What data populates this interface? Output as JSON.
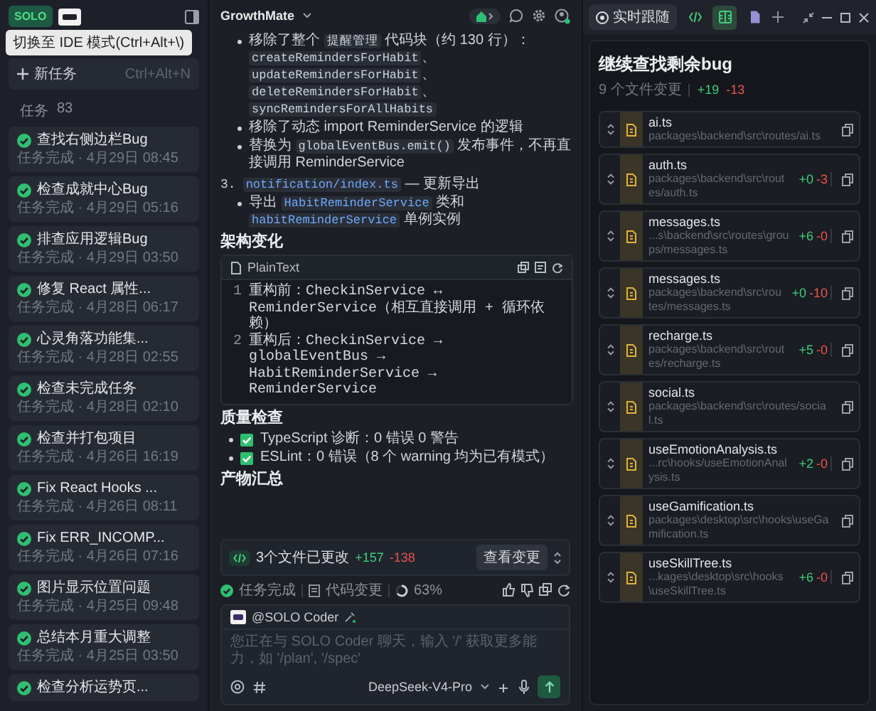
{
  "sidebar": {
    "badge": "SOLO",
    "tooltip": "切换至 IDE 模式(Ctrl+Alt+\\)",
    "new_task": {
      "label": "新任务",
      "shortcut": "Ctrl+Alt+N"
    },
    "tasks_label": "任务",
    "tasks_count": "83",
    "tasks": [
      {
        "title": "查找右侧边栏Bug",
        "subtitle": "任务完成 · 4月29日 08:45"
      },
      {
        "title": "检查成就中心Bug",
        "subtitle": "任务完成 · 4月29日 05:16"
      },
      {
        "title": "排查应用逻辑Bug",
        "subtitle": "任务完成 · 4月29日 03:50"
      },
      {
        "title": "修复 React 属性...",
        "subtitle": "任务完成 · 4月28日 06:17"
      },
      {
        "title": "心灵角落功能集...",
        "subtitle": "任务完成 · 4月28日 02:55"
      },
      {
        "title": "检查未完成任务",
        "subtitle": "任务完成 · 4月28日 02:10"
      },
      {
        "title": "检查并打包项目",
        "subtitle": "任务完成 · 4月26日 16:19"
      },
      {
        "title": "Fix React Hooks ...",
        "subtitle": "任务完成 · 4月26日 08:11"
      },
      {
        "title": "Fix ERR_INCOMP...",
        "subtitle": "任务完成 · 4月26日 07:16"
      },
      {
        "title": "图片显示位置问题",
        "subtitle": "任务完成 · 4月25日 09:48"
      },
      {
        "title": "总结本月重大调整",
        "subtitle": "任务完成 · 4月25日 03:50"
      },
      {
        "title": "检查分析运势页..."
      }
    ]
  },
  "chat": {
    "project": "GrowthMate",
    "blocks": [
      {
        "kind": "list_continued",
        "children": [
          {
            "kind": "bullet",
            "segments": [
              {
                "text": "移除了整个 "
              },
              {
                "text": "提醒管理",
                "code": true
              },
              {
                "text": " 代码块（约 130 行）："
              },
              {
                "text": "createRemindersForHabit",
                "code": true
              },
              {
                "text": "、"
              },
              {
                "text": "updateRemindersForHabit",
                "code": true
              },
              {
                "text": "、"
              },
              {
                "text": "deleteRemindersForHabit",
                "code": true
              },
              {
                "text": "、"
              },
              {
                "text": "syncRemindersForAllHabits",
                "code": true
              }
            ]
          },
          {
            "kind": "bullet",
            "segments": [
              {
                "text": "移除了动态 import ReminderService 的逻辑"
              }
            ]
          },
          {
            "kind": "bullet",
            "segments": [
              {
                "text": "替换为 "
              },
              {
                "text": "globalEventBus.emit()",
                "code": true
              },
              {
                "text": " 发布事件，不再直接调用 ReminderService"
              }
            ]
          }
        ]
      },
      {
        "kind": "numbered",
        "number": "3.",
        "segments": [
          {
            "text": "notification/index.ts",
            "code": true
          },
          {
            "text": " — 更新导出"
          }
        ],
        "children": [
          {
            "kind": "bullet",
            "segments": [
              {
                "text": "导出 "
              },
              {
                "text": "HabitReminderService",
                "code": true
              },
              {
                "text": " 类和 "
              },
              {
                "text": "habitReminderService",
                "code": true
              },
              {
                "text": " 单例实例"
              }
            ]
          }
        ]
      },
      {
        "kind": "heading",
        "text": "架构变化"
      },
      {
        "kind": "code",
        "language": "PlainText",
        "lines": [
          {
            "number": "1",
            "text": "重构前：CheckinService ↔ ReminderService（相互直接调用 + 循环依赖）"
          },
          {
            "number": "2",
            "text": "重构后：CheckinService → globalEventBus → HabitReminderService → ReminderService"
          }
        ]
      },
      {
        "kind": "heading",
        "text": "质量检查"
      },
      {
        "kind": "check",
        "checked": true,
        "segments": [
          {
            "text": "TypeScript 诊断：0 错误 0 警告"
          }
        ]
      },
      {
        "kind": "check",
        "checked": true,
        "segments": [
          {
            "text": "ESLint：0 错误（8 个 warning 均为已有模式）"
          }
        ]
      },
      {
        "kind": "heading",
        "text": "产物汇总"
      }
    ],
    "summary": {
      "text": "3个文件已更改",
      "added": "+157",
      "removed": "-138",
      "button": "查看变更"
    },
    "status": {
      "done": "任务完成",
      "changes": "代码变更",
      "progress": "63%"
    },
    "input": {
      "mention": "@SOLO Coder",
      "placeholder": "您正在与 SOLO Coder 聊天，输入 '/' 获取更多能力，如 '/plan', '/spec'",
      "model": "DeepSeek-V4-Pro"
    }
  },
  "review": {
    "follow": "实时跟随",
    "tabs": [
      {
        "kind": "code",
        "selected": false
      },
      {
        "kind": "split",
        "selected": true
      },
      {
        "kind": "file",
        "selected": false
      }
    ],
    "title": "继续查找剩余bug",
    "files_changed": "9 个文件变更",
    "added": "+19",
    "removed": "-13",
    "files": [
      {
        "name": "ai.ts",
        "path": "packages\\backend\\src\\routes/ai.ts"
      },
      {
        "name": "auth.ts",
        "path": "packages\\backend\\src\\routes/auth.ts",
        "added": "+0",
        "removed": "-3"
      },
      {
        "name": "messages.ts",
        "path": "...s\\backend\\src\\routes\\groups/messages.ts",
        "added": "+6",
        "removed": "-0"
      },
      {
        "name": "messages.ts",
        "path": "packages\\backend\\src\\routes/messages.ts",
        "added": "+0",
        "removed": "-10"
      },
      {
        "name": "recharge.ts",
        "path": "packages\\backend\\src\\routes/recharge.ts",
        "added": "+5",
        "removed": "-0"
      },
      {
        "name": "social.ts",
        "path": "packages\\backend\\src\\routes/social.ts"
      },
      {
        "name": "useEmotionAnalysis.ts",
        "path": "...rc\\hooks/useEmotionAnalysis.ts",
        "added": "+2",
        "removed": "-0"
      },
      {
        "name": "useGamification.ts",
        "path": "packages\\desktop\\src\\hooks\\useGamification.ts"
      },
      {
        "name": "useSkillTree.ts",
        "path": "...kages\\desktop\\src\\hooks\\useSkillTree.ts",
        "added": "+6",
        "removed": "-0"
      }
    ]
  }
}
